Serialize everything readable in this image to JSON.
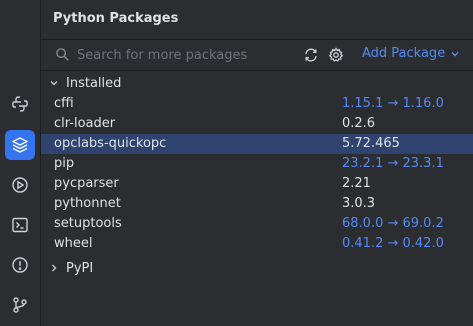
{
  "panel": {
    "title": "Python Packages",
    "search_placeholder": "Search for more packages",
    "add_package_label": "Add Package"
  },
  "groups": {
    "installed_label": "Installed",
    "pypi_label": "PyPI"
  },
  "packages": [
    {
      "name": "cffi",
      "version": "1.15.1 → 1.16.0",
      "has_update": true
    },
    {
      "name": "clr-loader",
      "version": "0.2.6",
      "has_update": false
    },
    {
      "name": "opclabs-quickopc",
      "version": "5.72.465",
      "has_update": false,
      "selected": true
    },
    {
      "name": "pip",
      "version": "23.2.1 → 23.3.1",
      "has_update": true
    },
    {
      "name": "pycparser",
      "version": "2.21",
      "has_update": false
    },
    {
      "name": "pythonnet",
      "version": "3.0.3",
      "has_update": false
    },
    {
      "name": "setuptools",
      "version": "68.0.0 → 69.0.2",
      "has_update": true
    },
    {
      "name": "wheel",
      "version": "0.41.2 → 0.42.0",
      "has_update": true
    }
  ],
  "toolwindow_icons": [
    "python-console-icon",
    "python-packages-icon",
    "services-icon",
    "terminal-icon",
    "problems-icon",
    "git-icon"
  ],
  "colors": {
    "accent": "#548af7",
    "selected_row": "#2e436e",
    "active_tool": "#3574f0"
  }
}
